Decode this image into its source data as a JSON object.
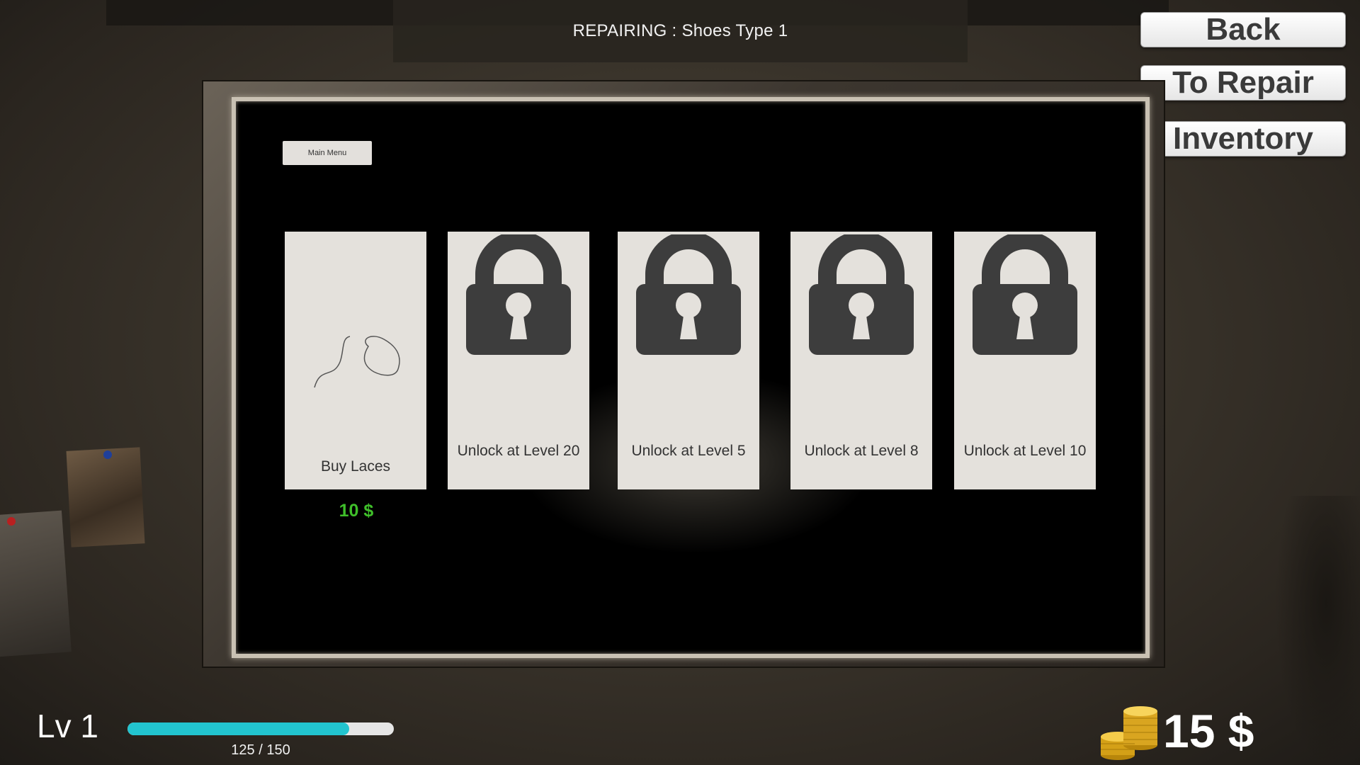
{
  "header": {
    "title": "REPAIRING : Shoes Type 1"
  },
  "nav": {
    "back_label": "Back",
    "to_repair_label": "To Repair",
    "inventory_label": "Inventory"
  },
  "panel": {
    "main_menu_label": "Main Menu",
    "cards": [
      {
        "label": "Buy Laces",
        "price": "10 $",
        "icon": "laces-icon",
        "locked": false
      },
      {
        "label": "Unlock at Level 20",
        "icon": "lock-icon",
        "locked": true
      },
      {
        "label": "Unlock at Level 5",
        "icon": "lock-icon",
        "locked": true
      },
      {
        "label": "Unlock at Level 8",
        "icon": "lock-icon",
        "locked": true
      },
      {
        "label": "Unlock at Level 10",
        "icon": "lock-icon",
        "locked": true
      }
    ]
  },
  "hud": {
    "level_label": "Lv 1",
    "xp_text": "125 / 150",
    "xp_current": 125,
    "xp_max": 150,
    "money": "15 $",
    "coin_icon": "coin-stack-icon"
  },
  "colors": {
    "xp_fill": "#22c4cf",
    "price": "#3fbf2a"
  }
}
